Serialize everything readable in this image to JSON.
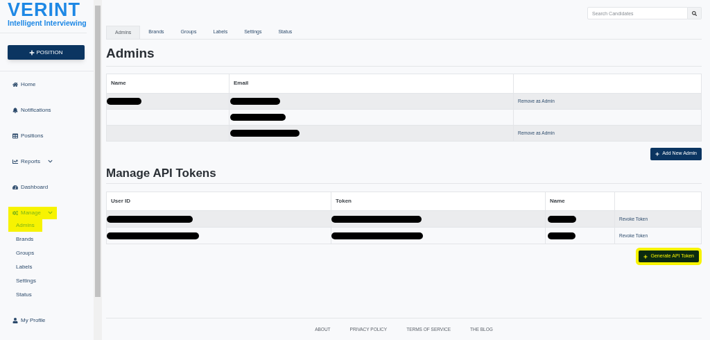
{
  "sidebar": {
    "logo": {
      "name": "VERINT",
      "tagline": "Intelligent Interviewing"
    },
    "new_button": {
      "label": "POSITION"
    },
    "items": [
      {
        "label": "Home",
        "selected": false,
        "has_caret": false
      },
      {
        "label": "Notifications",
        "selected": false,
        "has_caret": false
      },
      {
        "label": "Positions",
        "selected": false,
        "has_caret": false
      },
      {
        "label": "Reports",
        "selected": false,
        "has_caret": true
      },
      {
        "label": "Dashboard",
        "selected": false,
        "has_caret": false
      },
      {
        "label": "Manage",
        "selected": true,
        "highlighted": true,
        "has_caret": true,
        "children": [
          {
            "label": "Admins",
            "selected": true,
            "highlighted": true
          },
          {
            "label": "Brands",
            "selected": false,
            "highlighted": false
          },
          {
            "label": "Groups",
            "selected": false,
            "highlighted": false
          },
          {
            "label": "Labels",
            "selected": false,
            "highlighted": false
          },
          {
            "label": "Settings",
            "selected": false,
            "highlighted": false
          },
          {
            "label": "Status",
            "selected": false,
            "highlighted": false
          }
        ]
      },
      {
        "label": "My Profile",
        "selected": false,
        "has_caret": false
      }
    ]
  },
  "search": {
    "placeholder": "Search Candidates"
  },
  "tabs": [
    {
      "label": "Admins",
      "selected": true
    },
    {
      "label": "Brands",
      "selected": false
    },
    {
      "label": "Groups",
      "selected": false
    },
    {
      "label": "Labels",
      "selected": false
    },
    {
      "label": "Settings",
      "selected": false
    },
    {
      "label": "Status",
      "selected": false
    }
  ],
  "admins": {
    "title": "Admins",
    "columns": [
      "Name",
      "Email"
    ],
    "rows": [
      {
        "name_redacted": true,
        "email_redacted": true,
        "action": "Remove as Admin"
      },
      {
        "name_redacted": false,
        "email_redacted": true
      },
      {
        "name_redacted": false,
        "email_redacted": true,
        "action": "Remove as Admin"
      }
    ],
    "add_button": {
      "label": "Add New Admin",
      "highlighted": false
    }
  },
  "tokens": {
    "title": "Manage API Tokens",
    "columns": [
      "User ID",
      "Token",
      "Name"
    ],
    "rows": [
      {
        "user_redacted": true,
        "token_redacted": true,
        "name_redacted": true,
        "action": "Revoke Token"
      },
      {
        "user_redacted": true,
        "token_redacted": true,
        "name_redacted": true,
        "action": "Revoke Token"
      }
    ],
    "generate_button": {
      "label": "Generate API Token",
      "highlighted": true
    }
  },
  "footer": {
    "links": [
      "ABOUT",
      "PRIVACY POLICY",
      "TERMS OF SERVICE",
      "THE BLOG"
    ]
  }
}
